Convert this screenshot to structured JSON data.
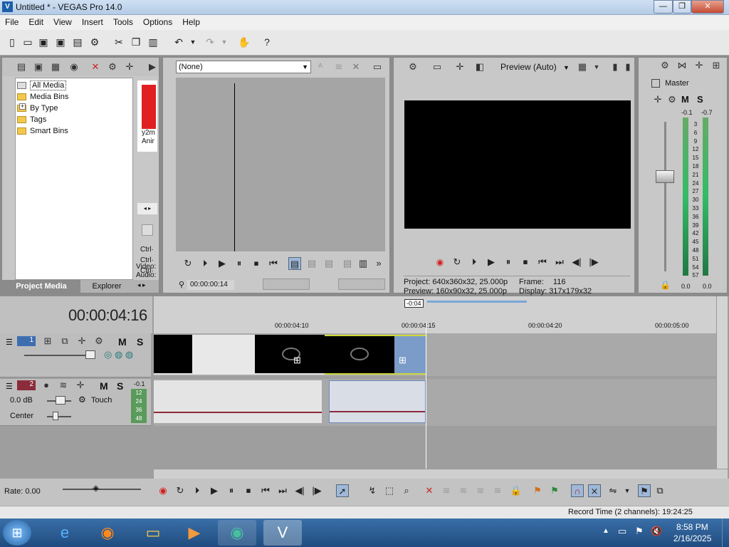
{
  "window": {
    "title": "Untitled * - VEGAS Pro 14.0",
    "app_icon": "vegas-icon",
    "minimize": "—",
    "maximize": "❐",
    "close": "✕"
  },
  "menu": [
    "File",
    "Edit",
    "View",
    "Insert",
    "Tools",
    "Options",
    "Help"
  ],
  "media_tree": {
    "items": [
      "All Media",
      "Media Bins",
      "By Type",
      "Tags",
      "Smart Bins"
    ],
    "expander": "+",
    "thumb_text": [
      "y2m",
      "Anir"
    ],
    "ctrl_labels": [
      "Ctrl·",
      "Ctrl·",
      "Ctrl·"
    ],
    "video_label": "Video:",
    "audio_label": "Audio:",
    "tabs": [
      "Project Media",
      "Explorer"
    ]
  },
  "trimmer": {
    "dropdown": "(None)",
    "timecode": "00:00:00:14"
  },
  "preview": {
    "mode": "Preview (Auto)",
    "project_label": "Project:",
    "project_value": "640x360x32, 25.000p",
    "preview_label": "Preview:",
    "preview_value": "160x90x32, 25.000p",
    "frame_label": "Frame:",
    "frame_value": "116",
    "display_label": "Display:",
    "display_value": "317x179x32"
  },
  "mixer": {
    "title": "Master",
    "peak_left": "-0.1",
    "peak_right": "-0.7",
    "scale": [
      "3",
      "6",
      "9",
      "12",
      "15",
      "18",
      "21",
      "24",
      "27",
      "30",
      "33",
      "36",
      "39",
      "42",
      "45",
      "48",
      "51",
      "54",
      "57"
    ],
    "bottom_left": "0.0",
    "bottom_right": "0.0",
    "ms": [
      "M",
      "S"
    ]
  },
  "timeline": {
    "cursor_time": "00:00:04:16",
    "loop_marker": "-0:04",
    "ruler_labels": [
      "00:00:04:10",
      "00:00:04:15",
      "00:00:04:20",
      "00:00:05:00"
    ],
    "track1_num": "1",
    "track2_num": "2",
    "audio_vol": "0.0 dB",
    "audio_pan": "Center",
    "touch": "Touch",
    "track_peak": "-0.1",
    "mini_meter": [
      "12",
      "24",
      "36",
      "48"
    ],
    "rate": "Rate: 0.00",
    "record_time": "Record Time (2 channels): 19:24:25"
  },
  "taskbar": {
    "time": "8:58 PM",
    "date": "2/16/2025"
  },
  "colors": {
    "accent": "#3d7ab8",
    "selected_event": "#7b9cc8",
    "record_red": "#d42020"
  }
}
